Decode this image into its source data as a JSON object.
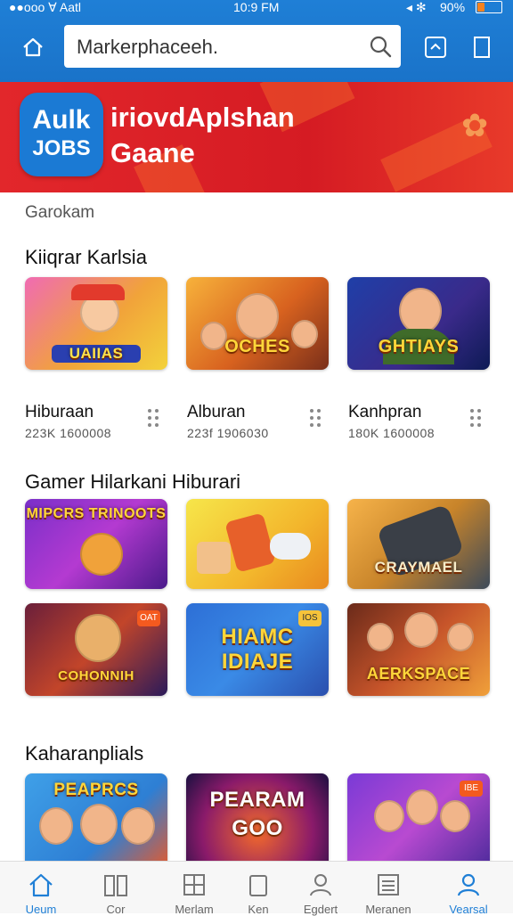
{
  "status_bar": {
    "left": "●●ooo ∀ Aatl",
    "time": "10:9 FM",
    "battery": "90%"
  },
  "header": {
    "search_placeholder": "Markerphaceeh.",
    "home_icon": "home-icon",
    "search_icon": "search-icon",
    "share_icon": "share-icon",
    "bookmark_icon": "bookmark-icon"
  },
  "banner": {
    "logo_line1": "Aulk",
    "logo_line2": "JOBS",
    "title_line1": "iriovdAplshan",
    "title_line2": "Gaane"
  },
  "subtitle": "Garokam",
  "sections": [
    {
      "title": "Kiiqrar Karlsia",
      "items": [
        {
          "art": "UAIIAS",
          "label": "Hiburaan",
          "meta": "223K 1600008"
        },
        {
          "art": "OCHES",
          "label": "Alburan",
          "meta": "223f 1906030"
        },
        {
          "art": "GHTIAYS",
          "label": "Kanhpran",
          "meta": "180K 1600008"
        }
      ]
    },
    {
      "title": "Gamer Hilarkani  Hiburari",
      "items": [
        {
          "art": "MIPCRS TRINOOTS"
        },
        {
          "art": ""
        },
        {
          "art": "CRAYMAEL"
        },
        {
          "art": "COHONNIH",
          "badge": "OAT"
        },
        {
          "art": "HIAMC IDIAJE",
          "badge": "IOS"
        },
        {
          "art": "AERKSPACE"
        }
      ]
    },
    {
      "title": "Kaharanplials",
      "items": [
        {
          "art": "PEAPRCS"
        },
        {
          "art": "PEARAM GOO"
        },
        {
          "art": "",
          "badge": "IBE"
        }
      ]
    }
  ],
  "tabs": [
    {
      "label": "Ueum",
      "icon": "home-icon",
      "active": true
    },
    {
      "label": "Cor",
      "icon": "book-icon"
    },
    {
      "label": "Merlam",
      "icon": "grid-icon"
    },
    {
      "label": "Ken",
      "icon": "bag-icon"
    },
    {
      "label": "Egdert",
      "icon": "person-icon"
    },
    {
      "label": "Meranen",
      "icon": "list-icon"
    },
    {
      "label": "Vearsal",
      "icon": "profile-icon",
      "active": true
    }
  ]
}
